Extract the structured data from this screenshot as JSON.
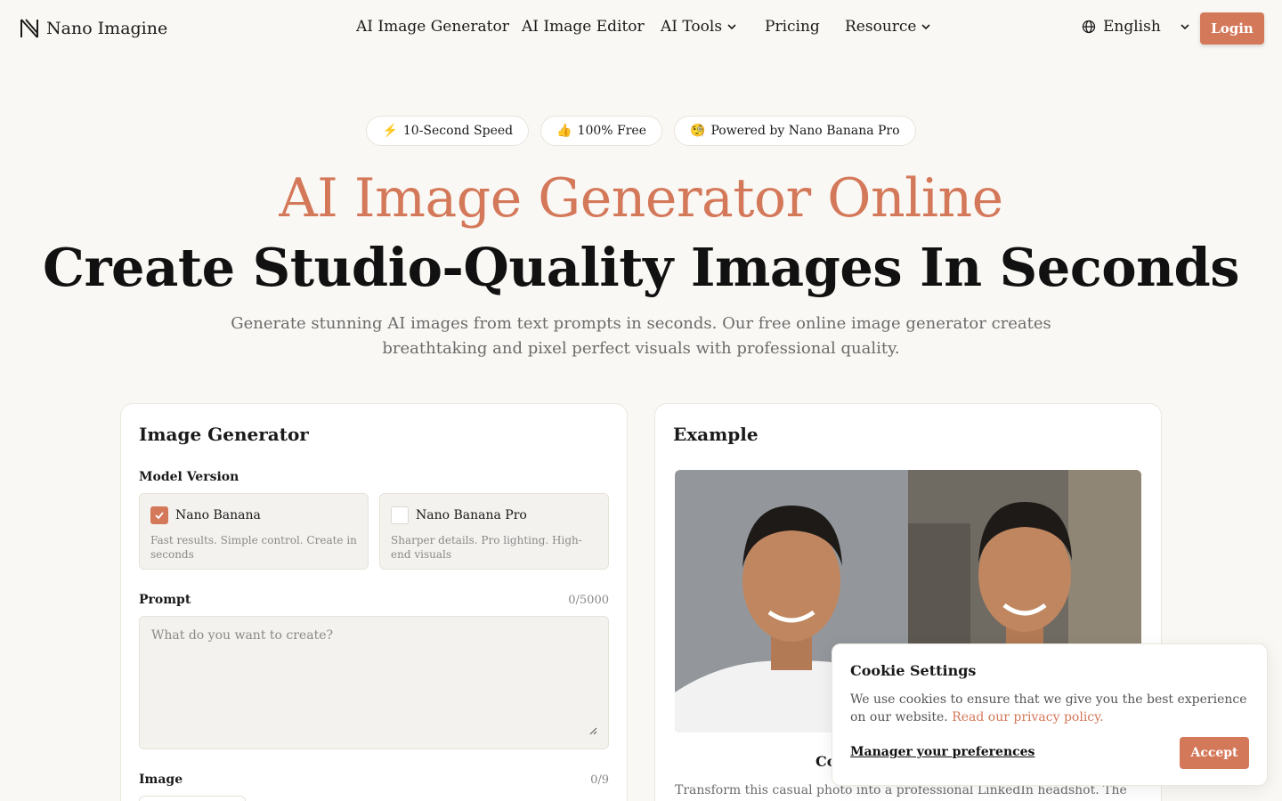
{
  "header": {
    "brand": "Nano Imagine",
    "nav": [
      {
        "label": "AI Image Generator"
      },
      {
        "label": "AI Image Editor"
      },
      {
        "label": "AI Tools"
      },
      {
        "label": "Pricing"
      },
      {
        "label": "Resource"
      }
    ],
    "language": "English",
    "login_label": "Login"
  },
  "badges": [
    {
      "emoji": "⚡",
      "label": "10-Second Speed"
    },
    {
      "emoji": "👍",
      "label": "100% Free"
    },
    {
      "emoji": "🧐",
      "label": "Powered by Nano Banana Pro"
    }
  ],
  "hero": {
    "title": "AI Image Generator Online",
    "subtitle": "Create Studio-Quality Images In Seconds",
    "description": "Generate stunning AI images from text prompts in seconds. Our free online image generator creates breathtaking and pixel perfect visuals with professional quality."
  },
  "generator": {
    "title": "Image Generator",
    "model_label": "Model Version",
    "models": [
      {
        "name": "Nano Banana",
        "description": "Fast results. Simple control. Create in seconds",
        "checked": true
      },
      {
        "name": "Nano Banana Pro",
        "description": "Sharper details. Pro lighting. High-end visuals",
        "checked": false
      }
    ],
    "prompt_label": "Prompt",
    "prompt_counter": "0/5000",
    "prompt_value": "",
    "prompt_placeholder": "What do you want to create?",
    "image_label": "Image",
    "image_counter": "0/9"
  },
  "example": {
    "title": "Example",
    "caption": "Co",
    "text": "Transform this casual photo into a professional LinkedIn headshot. The"
  },
  "cookie": {
    "title": "Cookie Settings",
    "text": "We use cookies to ensure that we give you the best experience on our website.",
    "link": "Read our privacy policy.",
    "manage": "Manager your preferences",
    "accept": "Accept"
  },
  "colors": {
    "accent": "#d4785a",
    "background": "#faf8f4"
  }
}
